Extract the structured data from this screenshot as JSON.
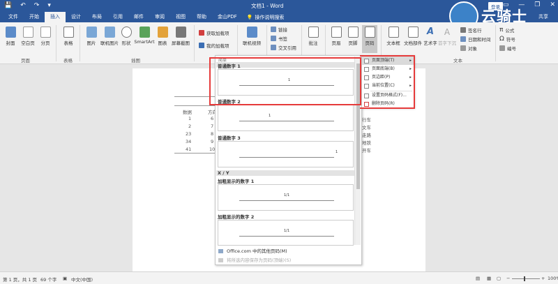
{
  "titlebar": {
    "title": "文档1 - Word",
    "login": "登录",
    "qat": [
      "💾",
      "↶",
      "↷",
      "▾"
    ],
    "winctl": [
      "▭",
      "—",
      "❐",
      "✕"
    ]
  },
  "watermark": {
    "text": "云骑士"
  },
  "tabs": [
    "文件",
    "开始",
    "插入",
    "设计",
    "布局",
    "引用",
    "邮件",
    "审阅",
    "视图",
    "帮助",
    "金山PDF"
  ],
  "active_tab": "插入",
  "tell_me": "操作说明搜索",
  "share": "共享",
  "ribbon": {
    "cover": "封面",
    "blank": "空白页",
    "break": "分页",
    "table": "表格",
    "picture": "图片",
    "online_picture": "联机图片",
    "shapes": "形状",
    "smartart": "SmartArt",
    "chart": "图表",
    "screenshot": "屏幕截图",
    "get_addins": "获取加载项",
    "my_addins": "我的加载项",
    "online_video": "联机视频",
    "link": "链接",
    "bookmark": "书签",
    "cross_ref": "交叉引用",
    "comment": "批注",
    "header": "页眉",
    "footer": "页脚",
    "page_number": "页码",
    "textbox": "文本框",
    "doc_parts": "文档部件",
    "wordart": "艺术字",
    "dropcap": "首字下沉",
    "signature": "签名行",
    "datetime": "日期和时间",
    "object": "对象",
    "equation": "公式",
    "symbol": "符号",
    "numbering": "编号",
    "groups": {
      "pages": "页面",
      "tables": "表格",
      "illustrations": "插图",
      "text": "文本"
    }
  },
  "document": {
    "header_cells": [
      "数据",
      "方向"
    ],
    "rows": [
      [
        "1",
        "6"
      ],
      [
        "2",
        "7"
      ],
      [
        "23",
        "8"
      ],
      [
        "34",
        "9"
      ],
      [
        "41",
        "10"
      ]
    ],
    "right_cells": [
      "行车",
      "文车",
      "走路",
      "地铁",
      "开车"
    ]
  },
  "gallery": {
    "header": "简单",
    "sections": [
      {
        "title": "普通数字 1",
        "num": "1"
      },
      {
        "title": "普通数字 2",
        "num": "1"
      },
      {
        "title": "普通数字 3",
        "num": "1"
      }
    ],
    "band": "X / Y",
    "bold_sections": [
      {
        "title": "加粗显示的数字 1",
        "num": "1/1"
      },
      {
        "title": "加粗显示的数字 2",
        "num": "1/1"
      }
    ],
    "menu": [
      "Office.com 中的其他页码(M)",
      "将所选内容保存为页码(顶端)(S)"
    ]
  },
  "submenu": {
    "items": [
      "页面顶端(T)",
      "页面底端(B)",
      "页边距(P)",
      "当前位置(C)",
      "设置页码格式(F)...",
      "删除页码(R)"
    ]
  },
  "status": {
    "page": "第 1 页，共 1 页",
    "words": "69 个字",
    "lang": "中文(中国)",
    "zoom": "100%"
  }
}
